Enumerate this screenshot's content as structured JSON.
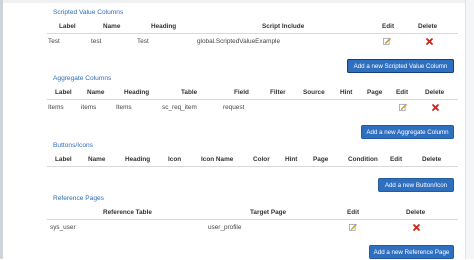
{
  "scripted": {
    "title": "Scripted Value Columns",
    "headers": [
      "Label",
      "Name",
      "Heading",
      "Script Include",
      "Edit",
      "Delete"
    ],
    "row": {
      "label": "Test",
      "name": "test",
      "heading": "Test",
      "script_include": "global.ScriptedValueExample"
    },
    "add_button": "Add a new Scripted Value Column"
  },
  "aggregate": {
    "title": "Aggregate Columns",
    "headers": [
      "Label",
      "Name",
      "Heading",
      "Table",
      "Field",
      "Filter",
      "Source",
      "Hint",
      "Page",
      "Edit",
      "Delete"
    ],
    "row": {
      "label": "Items",
      "name": "items",
      "heading": "Items",
      "table": "sc_req_item",
      "field": "request"
    },
    "add_button": "Add a new Aggregate Column"
  },
  "buttons": {
    "title": "Buttons/Icons",
    "headers": [
      "Label",
      "Name",
      "Heading",
      "Icon",
      "Icon Name",
      "Color",
      "Hint",
      "Page",
      "Condition",
      "Edit",
      "Delete"
    ],
    "add_button": "Add a new Button/Icon"
  },
  "reference": {
    "title": "Reference Pages",
    "headers": [
      "Reference Table",
      "Target Page",
      "Edit",
      "Delete"
    ],
    "row": {
      "table": "sys_user",
      "target_page": "user_profile"
    },
    "add_button": "Add a new Reference Page"
  },
  "icons": {
    "edit": "edit-pencil-icon",
    "delete": "delete-x-icon"
  },
  "colors": {
    "accent": "#2f6fc0",
    "title": "#2d6db5",
    "delete": "#d0271d",
    "edit": "#e8a020"
  }
}
